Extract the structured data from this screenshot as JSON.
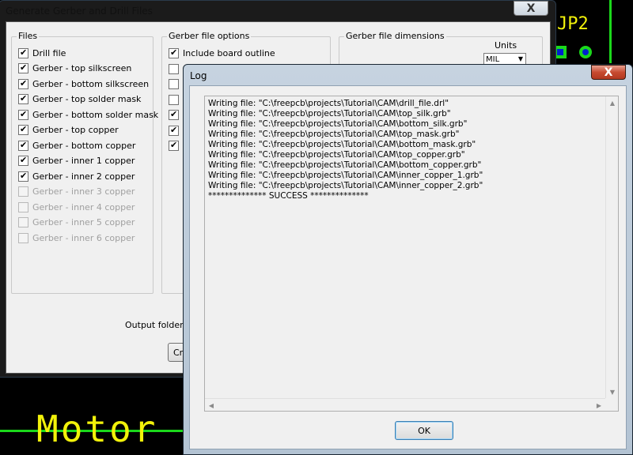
{
  "pcb": {
    "silk_text": "Motor C",
    "ref_text": "JP2"
  },
  "gerber_dialog": {
    "title": "Generate Gerber and Drill Files",
    "close_label": "X",
    "files_group": {
      "label": "Files",
      "items": [
        {
          "label": "Drill file",
          "checked": true,
          "enabled": true
        },
        {
          "label": "Gerber - top silkscreen",
          "checked": true,
          "enabled": true
        },
        {
          "label": "Gerber - bottom silkscreen",
          "checked": true,
          "enabled": true
        },
        {
          "label": "Gerber - top solder mask",
          "checked": true,
          "enabled": true
        },
        {
          "label": "Gerber - bottom solder mask",
          "checked": true,
          "enabled": true
        },
        {
          "label": "Gerber - top copper",
          "checked": true,
          "enabled": true
        },
        {
          "label": "Gerber - bottom copper",
          "checked": true,
          "enabled": true
        },
        {
          "label": "Gerber - inner 1 copper",
          "checked": true,
          "enabled": true
        },
        {
          "label": "Gerber - inner 2 copper",
          "checked": true,
          "enabled": true
        },
        {
          "label": "Gerber - inner 3 copper",
          "checked": false,
          "enabled": false
        },
        {
          "label": "Gerber - inner 4 copper",
          "checked": false,
          "enabled": false
        },
        {
          "label": "Gerber - inner 5 copper",
          "checked": false,
          "enabled": false
        },
        {
          "label": "Gerber - inner 6 copper",
          "checked": false,
          "enabled": false
        }
      ]
    },
    "options_group": {
      "label": "Gerber file options",
      "first_item": "Include board outline",
      "checks": [
        true,
        false,
        false,
        false,
        true,
        true,
        true
      ]
    },
    "dimensions_group": {
      "label": "Gerber file dimensions",
      "units_label": "Units",
      "units_value": "MIL"
    },
    "output_folder_label": "Output folder:",
    "create_button_partial": "Cr"
  },
  "log_dialog": {
    "title": "Log",
    "close_label": "X",
    "lines": [
      "Writing file: \"C:\\freepcb\\projects\\Tutorial\\CAM\\drill_file.drl\"",
      "Writing file: \"C:\\freepcb\\projects\\Tutorial\\CAM\\top_silk.grb\"",
      "Writing file: \"C:\\freepcb\\projects\\Tutorial\\CAM\\bottom_silk.grb\"",
      "Writing file: \"C:\\freepcb\\projects\\Tutorial\\CAM\\top_mask.grb\"",
      "Writing file: \"C:\\freepcb\\projects\\Tutorial\\CAM\\bottom_mask.grb\"",
      "Writing file: \"C:\\freepcb\\projects\\Tutorial\\CAM\\top_copper.grb\"",
      "Writing file: \"C:\\freepcb\\projects\\Tutorial\\CAM\\bottom_copper.grb\"",
      "Writing file: \"C:\\freepcb\\projects\\Tutorial\\CAM\\inner_copper_1.grb\"",
      "Writing file: \"C:\\freepcb\\projects\\Tutorial\\CAM\\inner_copper_2.grb\"",
      "************** SUCCESS **************"
    ],
    "ok_label": "OK"
  }
}
